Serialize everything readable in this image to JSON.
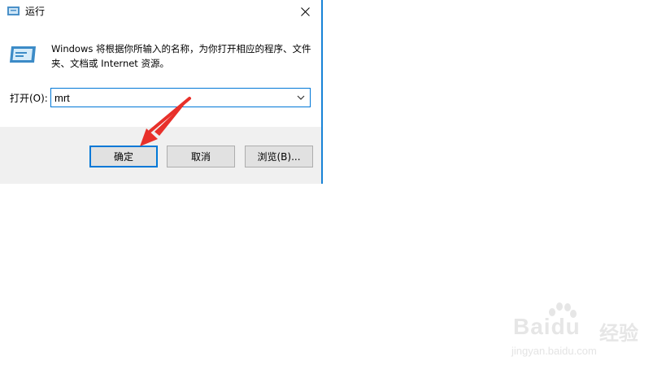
{
  "dialog": {
    "title": "运行",
    "description": "Windows 将根据你所输入的名称，为你打开相应的程序、文件夹、文档或 Internet 资源。",
    "open_label": "打开(O):",
    "input_value": "mrt",
    "buttons": {
      "ok": "确定",
      "cancel": "取消",
      "browse": "浏览(B)..."
    }
  },
  "watermark": {
    "brand": "Baidu",
    "brand_cn": "经验",
    "url": "jingyan.baidu.com"
  },
  "colors": {
    "accent": "#0078d7",
    "annotation_arrow": "#e8302a"
  },
  "icons": [
    "run-app-icon",
    "close-icon",
    "chevron-down-icon"
  ]
}
